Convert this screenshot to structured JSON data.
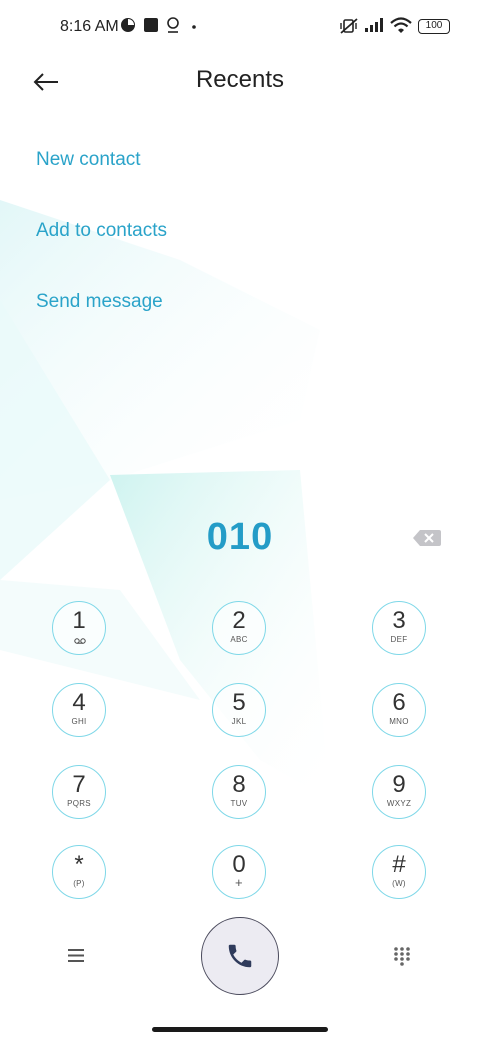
{
  "status_bar": {
    "time": "8:16 AM",
    "battery": "100",
    "icons": [
      "data-saver-icon",
      "square-notification-icon",
      "location-icon",
      "dot-icon",
      "vibrate-off-icon",
      "signal-icon",
      "wifi-icon",
      "battery-icon"
    ]
  },
  "header": {
    "title": "Recents",
    "back_icon": "back-arrow-icon"
  },
  "actions": [
    {
      "label": "New contact"
    },
    {
      "label": "Add to contacts"
    },
    {
      "label": "Send message"
    }
  ],
  "dialer": {
    "number": "010",
    "backspace_icon": "backspace-icon"
  },
  "keypad": [
    {
      "digit": "1",
      "letters": ""
    },
    {
      "digit": "2",
      "letters": "ABC"
    },
    {
      "digit": "3",
      "letters": "DEF"
    },
    {
      "digit": "4",
      "letters": "GHI"
    },
    {
      "digit": "5",
      "letters": "JKL"
    },
    {
      "digit": "6",
      "letters": "MNO"
    },
    {
      "digit": "7",
      "letters": "PQRS"
    },
    {
      "digit": "8",
      "letters": "TUV"
    },
    {
      "digit": "9",
      "letters": "WXYZ"
    },
    {
      "digit": "*",
      "letters": "(P)"
    },
    {
      "digit": "0",
      "letters": "+"
    },
    {
      "digit": "#",
      "letters": "(W)"
    }
  ],
  "bottom_bar": {
    "menu_icon": "menu-icon",
    "call_icon": "phone-icon",
    "dialpad_icon": "dialpad-icon"
  },
  "colors": {
    "accent": "#2aa3c9",
    "number": "#249cc7",
    "key_ring": "#7fd8e8",
    "call_bg": "#ecebf2"
  }
}
